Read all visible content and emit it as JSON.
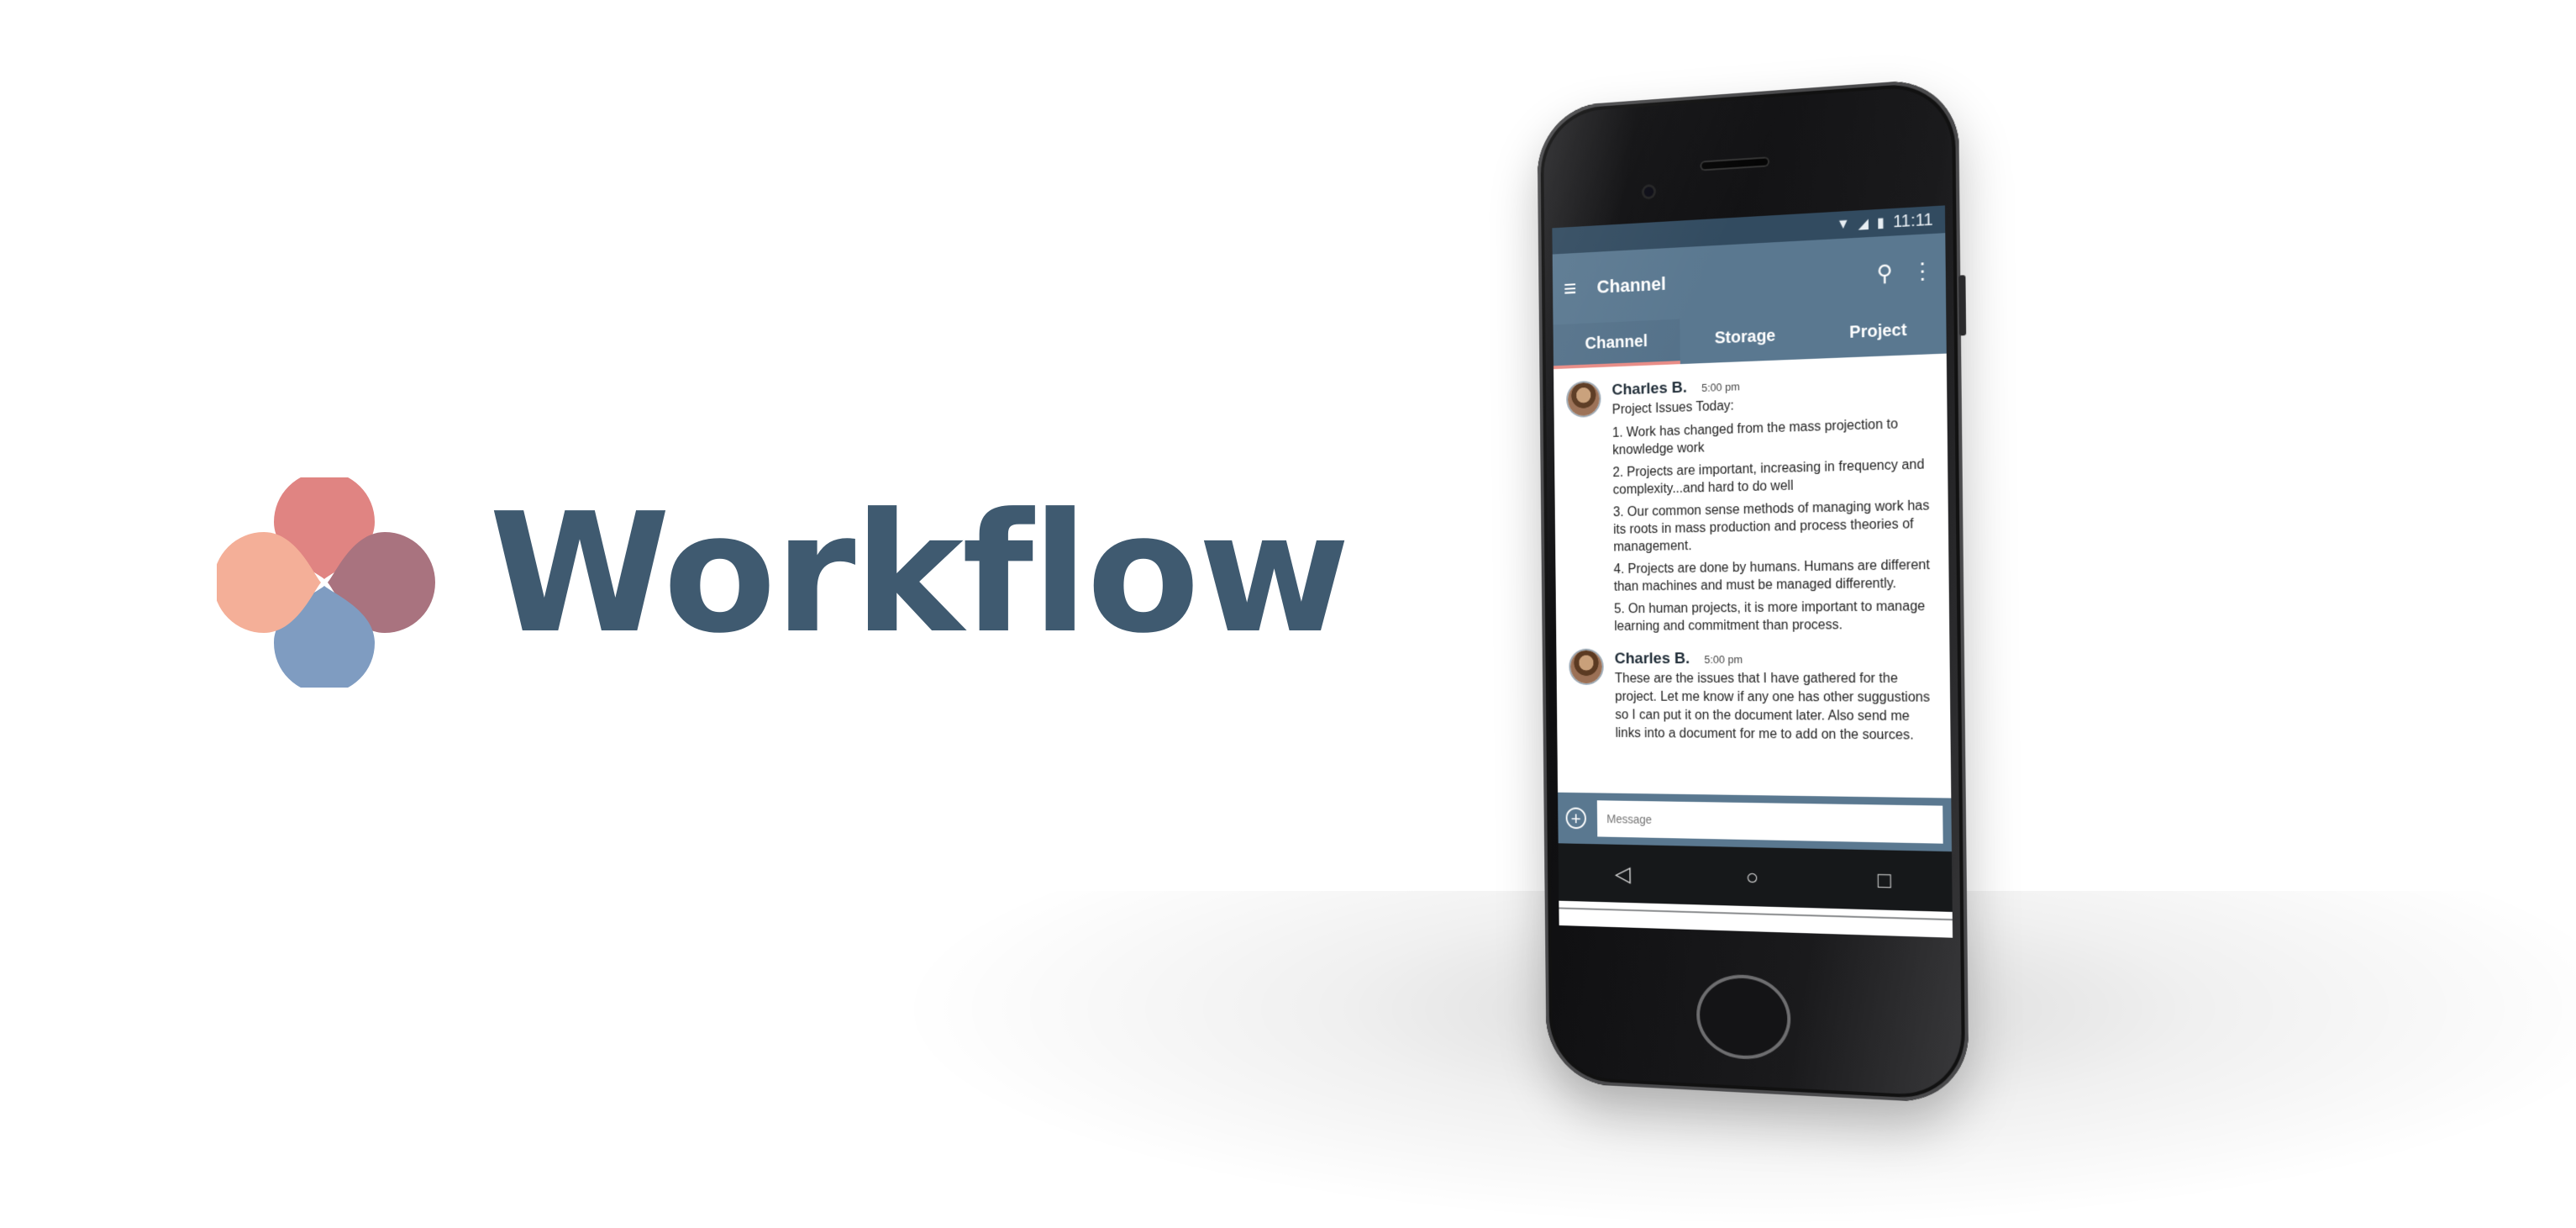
{
  "brand": {
    "name": "Workflow",
    "colors": {
      "text": "#3f5a70",
      "petal_top": "#e08482",
      "petal_right": "#a9737f",
      "petal_bottom": "#7f9cc1",
      "petal_left": "#f4af98"
    }
  },
  "phone": {
    "status_bar": {
      "time": "11:11",
      "icons": [
        "wifi-icon",
        "signal-icon",
        "battery-icon"
      ]
    },
    "app_bar": {
      "title": "Channel",
      "menu_icon": "menu-icon",
      "actions": [
        "search-icon",
        "more-vert-icon"
      ]
    },
    "tabs": [
      {
        "label": "Channel",
        "active": true
      },
      {
        "label": "Storage",
        "active": false
      },
      {
        "label": "Project",
        "active": false
      }
    ],
    "messages": [
      {
        "author": "Charles B.",
        "time": "5:00 pm",
        "intro": "Project Issues Today:",
        "items": [
          "1. Work has changed from the mass projection to knowledge work",
          "2. Projects are important, increasing in frequency and complexity...and hard to do well",
          "3. Our common sense methods of managing work has its roots in mass production and process theories of management.",
          "4. Projects are done by humans. Humans are different than machines and must be managed differently.",
          "5. On human projects, it is more important to manage learning and commitment than process."
        ]
      },
      {
        "author": "Charles B.",
        "time": "5:00 pm",
        "text": "These are the issues that I have gathered for the project. Let me know if any one has other suggustions so I can put it on the document later. Also send me links into a document for me to add on the sources."
      }
    ],
    "composer": {
      "placeholder": "Message",
      "add_icon": "add-circle-icon"
    },
    "nav": [
      "back-icon",
      "home-icon",
      "recents-icon"
    ]
  }
}
